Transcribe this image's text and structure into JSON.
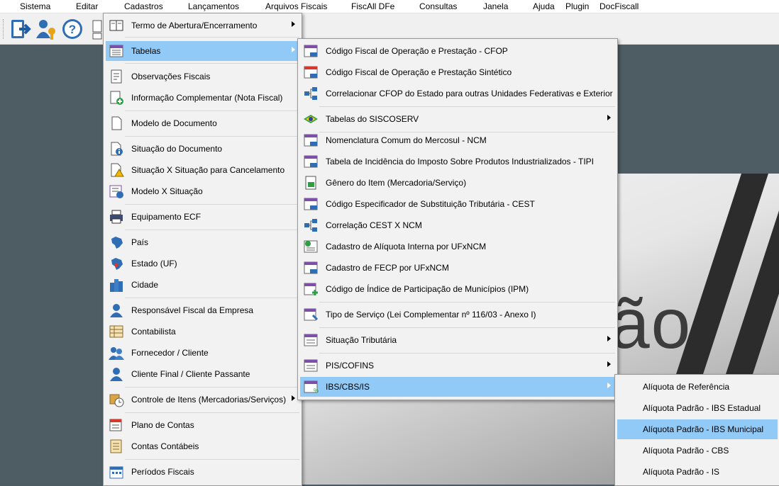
{
  "menubar": {
    "items": [
      "Sistema",
      "Editar",
      "Cadastros",
      "Lançamentos",
      "Arquivos Fiscais",
      "FiscAll DFe",
      "Consultas",
      "Janela",
      "Ajuda",
      "Plugin",
      "DocFiscall"
    ]
  },
  "toolbar": {
    "icons": [
      "exit-icon",
      "user-key-icon",
      "help-icon",
      "document-icon"
    ]
  },
  "banner": {
    "text": "ão"
  },
  "cadastros_menu": {
    "items": [
      {
        "label": "Termo de Abertura/Encerramento",
        "icon": "book-icon",
        "submenu": true
      },
      {
        "label": "Tabelas",
        "icon": "table-icon",
        "submenu": true,
        "highlighted": true
      },
      {
        "label": "Observações Fiscais",
        "icon": "notes-icon"
      },
      {
        "label": "Informação Complementar (Nota Fiscal)",
        "icon": "document-add-icon"
      },
      {
        "label": "Modelo de Documento",
        "icon": "page-icon"
      },
      {
        "label": "Situação do Documento",
        "icon": "info-document-icon"
      },
      {
        "label": "Situação X Situação para Cancelamento",
        "icon": "warning-document-icon"
      },
      {
        "label": "Modelo X Situação",
        "icon": "info-list-icon"
      },
      {
        "label": "Equipamento ECF",
        "icon": "printer-icon"
      },
      {
        "label": "País",
        "icon": "map-brazil-icon"
      },
      {
        "label": "Estado (UF)",
        "icon": "map-state-icon"
      },
      {
        "label": "Cidade",
        "icon": "buildings-icon"
      },
      {
        "label": "Responsável Fiscal da Empresa",
        "icon": "person-icon"
      },
      {
        "label": "Contabilista",
        "icon": "spreadsheet-icon"
      },
      {
        "label": "Fornecedor / Cliente",
        "icon": "people-icon"
      },
      {
        "label": "Cliente Final / Cliente Passante",
        "icon": "person-icon"
      },
      {
        "label": "Controle de Itens (Mercadorias/Serviços)",
        "icon": "box-clock-icon",
        "submenu": true
      },
      {
        "label": "Plano de Contas",
        "icon": "accounts-plan-icon"
      },
      {
        "label": "Contas Contábeis",
        "icon": "ledger-icon"
      },
      {
        "label": "Períodos Fiscais",
        "icon": "calendar-icon"
      }
    ]
  },
  "tabelas_menu": {
    "items": [
      {
        "label": "Código Fiscal de Operação e Prestação - CFOP",
        "icon": "cfop-table-icon"
      },
      {
        "label": "Código Fiscal de Operação e Prestação Sintético",
        "icon": "cfop-synthetic-icon"
      },
      {
        "label": "Correlacionar CFOP do Estado para outras Unidades Federativas e Exterior",
        "icon": "correlation-icon"
      },
      {
        "label": "Tabelas do SISCOSERV",
        "icon": "brazil-flag-icon",
        "submenu": true
      },
      {
        "label": "Nomenclatura Comum do Mercosul  - NCM",
        "icon": "ncm-table-icon"
      },
      {
        "label": "Tabela de Incidência do Imposto Sobre Produtos Industrializados - TIPI",
        "icon": "tipi-table-icon"
      },
      {
        "label": "Gênero do Item (Mercadoria/Serviço)",
        "icon": "item-genre-icon"
      },
      {
        "label": "Código Especificador de Substituição Tributária - CEST",
        "icon": "cest-table-icon"
      },
      {
        "label": "Correlação CEST X NCM",
        "icon": "correlation-icon"
      },
      {
        "label": "Cadastro de Alíquota Interna por UFxNCM",
        "icon": "rate-table-icon"
      },
      {
        "label": "Cadastro de FECP por UFxNCM",
        "icon": "fecp-table-icon"
      },
      {
        "label": "Código de Índice de Participação de Municípios (IPM)",
        "icon": "ipm-table-icon"
      },
      {
        "label": "Tipo de Serviço (Lei Complementar nº 116/03 - Anexo I)",
        "icon": "service-type-icon"
      },
      {
        "label": "Situação Tributária",
        "icon": "tax-situation-icon",
        "submenu": true
      },
      {
        "label": "PIS/COFINS",
        "icon": "pis-cofins-icon",
        "submenu": true
      },
      {
        "label": "IBS/CBS/IS",
        "icon": "ibs-cbs-icon",
        "submenu": true,
        "highlighted": true
      }
    ]
  },
  "ibs_menu": {
    "items": [
      {
        "label": "Alíquota de Referência"
      },
      {
        "label": "Alíquota Padrão - IBS Estadual"
      },
      {
        "label": "Alíquota Padrão - IBS Municipal",
        "highlighted": true
      },
      {
        "label": "Alíquota Padrão - CBS"
      },
      {
        "label": "Alíquota Padrão - IS"
      }
    ]
  },
  "colors": {
    "highlight": "#91c9f7",
    "menu_bg": "#f2f2f2",
    "workspace": "#4e5d64"
  }
}
